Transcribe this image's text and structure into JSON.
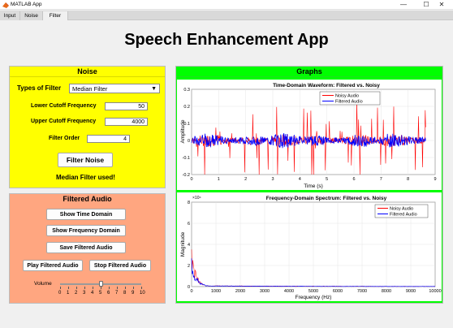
{
  "window": {
    "title": "MATLAB App",
    "controls": [
      "—",
      "☐",
      "✕"
    ]
  },
  "tabs": [
    {
      "label": "Input"
    },
    {
      "label": "Noise"
    },
    {
      "label": "Filter"
    }
  ],
  "app_title": "Speech Enhancement App",
  "noise_panel": {
    "title": "Noise",
    "filter_type_label": "Types of Filter",
    "filter_type_value": "Median Filter",
    "lower_cutoff_label": "Lower Cutoff Frequency",
    "lower_cutoff_value": "50",
    "upper_cutoff_label": "Upper Cutoff Frequency",
    "upper_cutoff_value": "4000",
    "filter_order_label": "Filter Order",
    "filter_order_value": "4",
    "filter_button": "Filter Noise",
    "status_text": "Median Filter used!",
    "bg_color": "#ffff00"
  },
  "filtered_panel": {
    "title": "Filtered Audio",
    "show_time_button": "Show Time Domain",
    "show_freq_button": "Show Frequency Domain",
    "save_button": "Save Filtered Audio",
    "play_button": "Play Filtered Audio",
    "stop_button": "Stop Filtered Audio",
    "volume_label": "Volume",
    "volume_value": 5,
    "volume_ticks": [
      "0",
      "1",
      "2",
      "3",
      "4",
      "5",
      "6",
      "7",
      "8",
      "9",
      "10"
    ],
    "bg_color": "#ffa680"
  },
  "graphs_panel": {
    "title": "Graphs",
    "bg_color": "#00ff00"
  },
  "chart_data": [
    {
      "type": "line",
      "title": "Time-Domain Waveform: Filtered vs. Noisy",
      "xlabel": "Time (s)",
      "ylabel": "Amplitude",
      "xlim": [
        0,
        9
      ],
      "ylim": [
        -0.2,
        0.3
      ],
      "xticks": [
        "0",
        "1",
        "2",
        "3",
        "4",
        "5",
        "6",
        "7",
        "8",
        "9"
      ],
      "yticks": [
        "-0.2",
        "-0.1",
        "0",
        "0.1",
        "0.2",
        "0.3"
      ],
      "legend": "top-right",
      "grid": true,
      "series": [
        {
          "name": "Noisy Audio",
          "color": "#ff0000",
          "min": -0.2,
          "max": 0.3
        },
        {
          "name": "Filtered Audio",
          "color": "#0000ff",
          "min": -0.06,
          "max": 0.06
        }
      ]
    },
    {
      "type": "line",
      "title": "Frequency-Domain Spectrum: Filtered vs. Noisy",
      "xlabel": "Frequency (Hz)",
      "ylabel": "Magnitude",
      "xlim": [
        0,
        10000
      ],
      "ylim": [
        0,
        8
      ],
      "y_exponent": "×10⁴",
      "xticks": [
        "0",
        "1000",
        "2000",
        "3000",
        "4000",
        "5000",
        "6000",
        "7000",
        "8000",
        "9000",
        "10000"
      ],
      "yticks": [
        "0",
        "2",
        "4",
        "6",
        "8"
      ],
      "legend": "top-right",
      "grid": true,
      "series": [
        {
          "name": "Noisy Audio",
          "color": "#ff0000"
        },
        {
          "name": "Filtered Audio",
          "color": "#0000ff"
        }
      ]
    }
  ]
}
